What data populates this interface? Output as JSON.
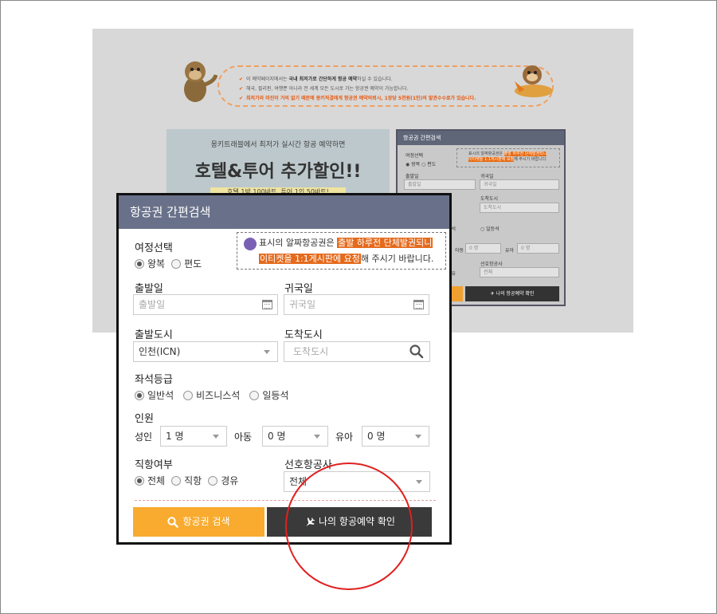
{
  "background": {
    "notice": {
      "line1": {
        "pre": "이 예약페이지에서는 ",
        "strong": "국내 최저가로 간단하게 항공 예약",
        "post": "하실 수 있습니다."
      },
      "line2": "해국, 필리핀, 여행뿐 아니라 전 세계 모든 도시로 가는 항공권 예약이 가능합니다.",
      "line3": {
        "pre": "최저가라 마진이 거의 없기 때문에 ",
        "hl": "몽키직결에게 항공권 예약의뢰시, 1장당 5천원(1인)의 발권수수료",
        "post": "가 있습니다."
      }
    },
    "promo": {
      "sub": "몽키트래블에서 최저가 실시간 항공 예약하면",
      "main": "호텔&투어 추가할인!!",
      "tag": "호텔 1박 100바트, 투어 1인 50바트!"
    },
    "mini_form": {
      "title": "항공권 간편검색",
      "trip_label": "여정선택",
      "trip_opt1": "왕복",
      "trip_opt2": "편도",
      "note_pre": "표시의 알짜항공권은 ",
      "note_hl1": "출발 하루전 단체발권되니",
      "note_hl2": "이티켓을 1:1게시판에 요청",
      "note_post": "해 주시기 바랍니다.",
      "depart_label": "출발일",
      "return_label": "귀국일",
      "depart_ph": "출발일",
      "return_ph": "귀국일",
      "arrive_label": "도착도시",
      "arrive_ph": "도착도시",
      "seat_frag": "소석",
      "seat_frag2": "일등석",
      "child_frag": "아동",
      "infant_frag": "유아",
      "count0": "0 명",
      "airline_label": "선호항공사",
      "airline_val": "전체",
      "route_frag": "경유",
      "booking_btn": "나의 항공예약 확인"
    }
  },
  "panel": {
    "title": "항공권 간편검색",
    "trip": {
      "label": "여정선택",
      "options": [
        "왕복",
        "편도"
      ],
      "selected": 0
    },
    "note": {
      "pre": "표시의 알짜항공권은 ",
      "hl1": "출발 하루전 단체발권되니",
      "hl2": "이티켓을 1:1게시판에 요청",
      "post": "해 주시기 바랍니다."
    },
    "depart_date": {
      "label": "출발일",
      "placeholder": "출발일"
    },
    "return_date": {
      "label": "귀국일",
      "placeholder": "귀국일"
    },
    "depart_city": {
      "label": "출발도시",
      "value": "인천(ICN)"
    },
    "arrive_city": {
      "label": "도착도시",
      "placeholder": "도착도시"
    },
    "seat": {
      "label": "좌석등급",
      "options": [
        "일반석",
        "비즈니스석",
        "일등석"
      ],
      "selected": 0
    },
    "people": {
      "label": "인원",
      "adult_label": "성인",
      "adult_value": "1 명",
      "child_label": "아동",
      "child_value": "0 명",
      "infant_label": "유아",
      "infant_value": "0 명"
    },
    "direct": {
      "label": "직항여부",
      "options": [
        "전체",
        "직항",
        "경유"
      ],
      "selected": 0
    },
    "airline": {
      "label": "선호항공사",
      "value": "전체"
    },
    "search_button": "항공권 검색",
    "booking_button": "나의 항공예약 확인"
  },
  "colors": {
    "header": "#69718a",
    "search_button": "#f8ab2f",
    "booking_button": "#3a3a3a",
    "highlight": "#e46a1c",
    "annotation_circle": "#e02020"
  }
}
